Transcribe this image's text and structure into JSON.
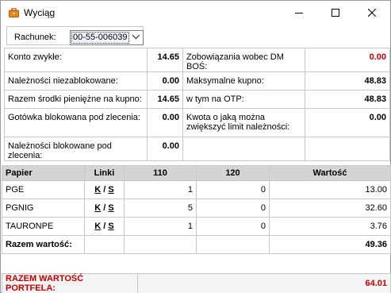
{
  "window": {
    "title": "Wyciąg"
  },
  "account": {
    "label": "Rachunek:",
    "selected": "00-55-006039"
  },
  "summary": {
    "konto_label": "Konto zwykłe:",
    "konto_value": "14.65",
    "zobow_label": "Zobowiązania wobec DM BOŚ:",
    "zobow_value": "0.00",
    "nalez_label": "Należności niezablokowane:",
    "nalez_value": "0.00",
    "maks_label": "Maksymalne kupno:",
    "maks_value": "48.83",
    "razem_label": "Razem środki pieniężne na kupno:",
    "razem_value": "14.65",
    "otp_label": "w tym na OTP:",
    "otp_value": "48.83",
    "gotowka_label": "Gotówka blokowana pod zlecenia:",
    "gotowka_value": "0.00",
    "kwota_label": "Kwota o jaką można zwiększyć limit należności:",
    "kwota_value": "0.00",
    "nalblok_label": "Należności blokowane pod zlecenia:",
    "nalblok_value": "0.00"
  },
  "papers": {
    "headers": {
      "papier": "Papier",
      "linki": "Linki",
      "c110": "110",
      "c120": "120",
      "wartosc": "Wartość"
    },
    "link_k": "K",
    "link_sep": "/",
    "link_s": "S",
    "rows": [
      {
        "name": "PGE",
        "c110": "1",
        "c120": "0",
        "value": "13.00"
      },
      {
        "name": "PGNIG",
        "c110": "5",
        "c120": "0",
        "value": "32.60"
      },
      {
        "name": "TAURONPE",
        "c110": "1",
        "c120": "0",
        "value": "3.76"
      }
    ],
    "sum_label": "Razem wartość:",
    "sum_value": "49.36"
  },
  "portfolio": {
    "label": "RAZEM WARTOŚĆ PORTFELA:",
    "value": "64.01"
  },
  "colors": {
    "accent_red": "#c00000",
    "header_bg": "#d4d4d4",
    "border": "#c8c8c8"
  }
}
